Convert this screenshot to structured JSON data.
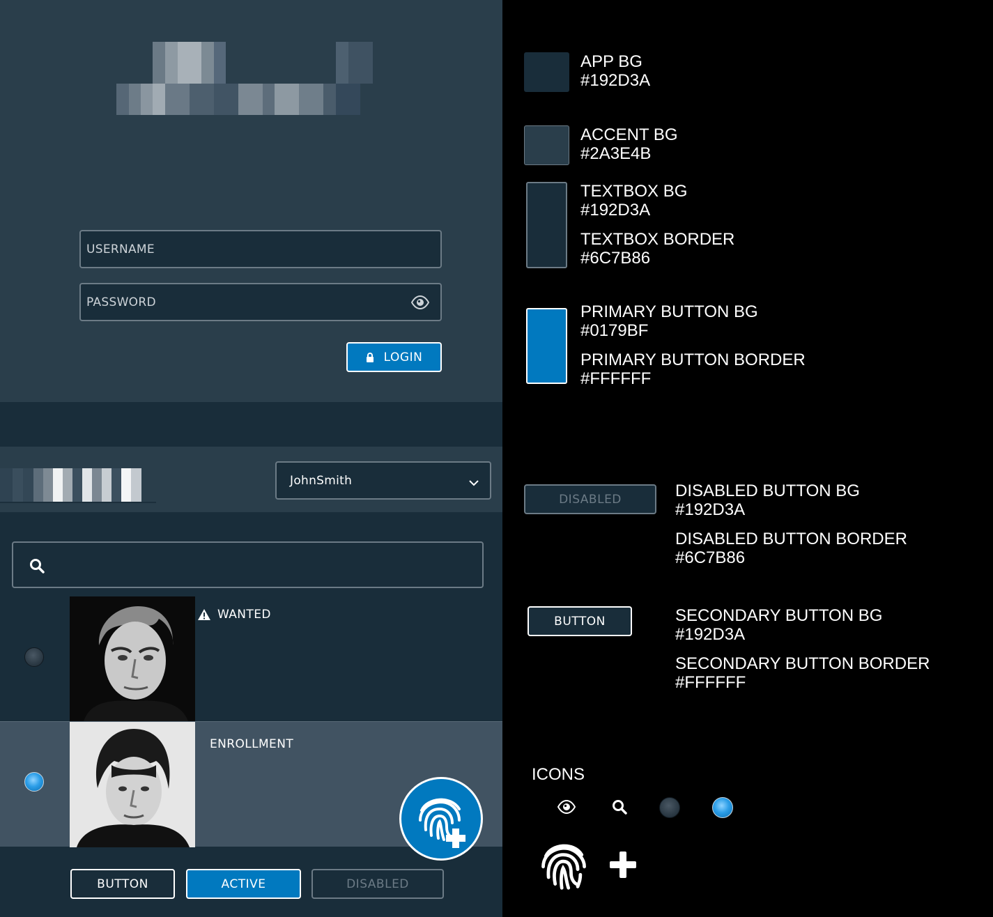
{
  "login": {
    "username_placeholder": "USERNAME",
    "password_placeholder": "PASSWORD",
    "login_label": "LOGIN"
  },
  "header": {
    "user_select_value": "JohnSmith"
  },
  "records": [
    {
      "tag": "WANTED",
      "selected": false
    },
    {
      "tag": "ENROLLMENT",
      "selected": true
    }
  ],
  "buttons": {
    "secondary_label": "BUTTON",
    "active_label": "ACTIVE",
    "disabled_label": "DISABLED"
  },
  "legend": {
    "app_bg": {
      "label": "APP BG",
      "hex": "#192D3A"
    },
    "accent_bg": {
      "label": "ACCENT BG",
      "hex": "#2A3E4B"
    },
    "textbox_bg": {
      "label": "TEXTBOX BG",
      "hex": "#192D3A"
    },
    "textbox_border": {
      "label": "TEXTBOX BORDER",
      "hex": "#6C7B86"
    },
    "primary_bg": {
      "label": "PRIMARY BUTTON BG",
      "hex": "#0179BF"
    },
    "primary_border": {
      "label": "PRIMARY BUTTON BORDER",
      "hex": "#FFFFFF"
    },
    "disabled_sample": "DISABLED",
    "disabled_bg": {
      "label": "DISABLED BUTTON BG",
      "hex": "#192D3A"
    },
    "disabled_border": {
      "label": "DISABLED BUTTON BORDER",
      "hex": "#6C7B86"
    },
    "secondary_sample": "BUTTON",
    "secondary_bg": {
      "label": "SECONDARY BUTTON BG",
      "hex": "#192D3A"
    },
    "secondary_border": {
      "label": "SECONDARY BUTTON BORDER",
      "hex": "#FFFFFF"
    },
    "icons_title": "ICONS",
    "icons": [
      "eye-icon",
      "search-icon",
      "radio-off-icon",
      "radio-on-icon",
      "fingerprint-icon",
      "plus-icon"
    ]
  }
}
